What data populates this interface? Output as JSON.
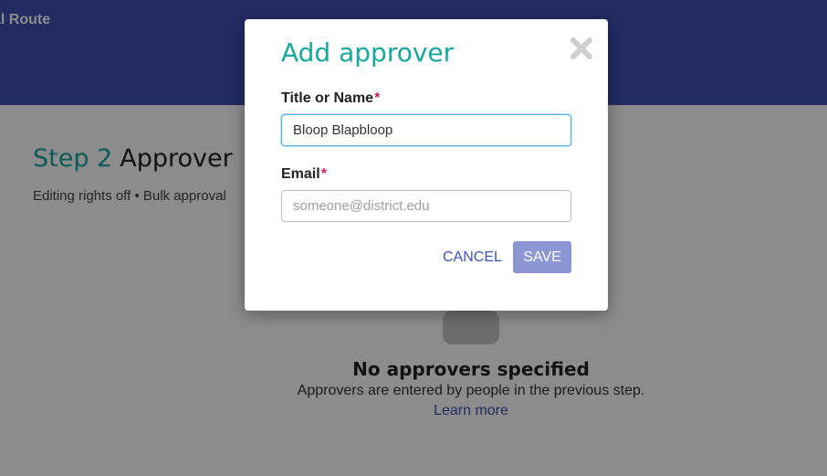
{
  "header": {
    "title": "al Route"
  },
  "step": {
    "number": "Step 2",
    "name": "Approver",
    "meta": "Editing rights off • Bulk approval"
  },
  "empty_state": {
    "icon": "person-icon",
    "title": "No approvers specified",
    "description": "Approvers are entered by people in the previous step.",
    "link": "Learn more"
  },
  "modal": {
    "title": "Add approver",
    "close_icon": "close-icon",
    "name_field": {
      "label": "Title or Name",
      "required_mark": "*",
      "value": "Bloop Blapbloop"
    },
    "email_field": {
      "label": "Email",
      "required_mark": "*",
      "placeholder": "someone@district.edu"
    },
    "cancel_label": "CANCEL",
    "save_label": "SAVE"
  },
  "colors": {
    "header": "#3f51b5",
    "accent": "#16a89c",
    "link": "#3f51b5",
    "save_disabled": "#8c96d2",
    "required": "#d81b60"
  }
}
